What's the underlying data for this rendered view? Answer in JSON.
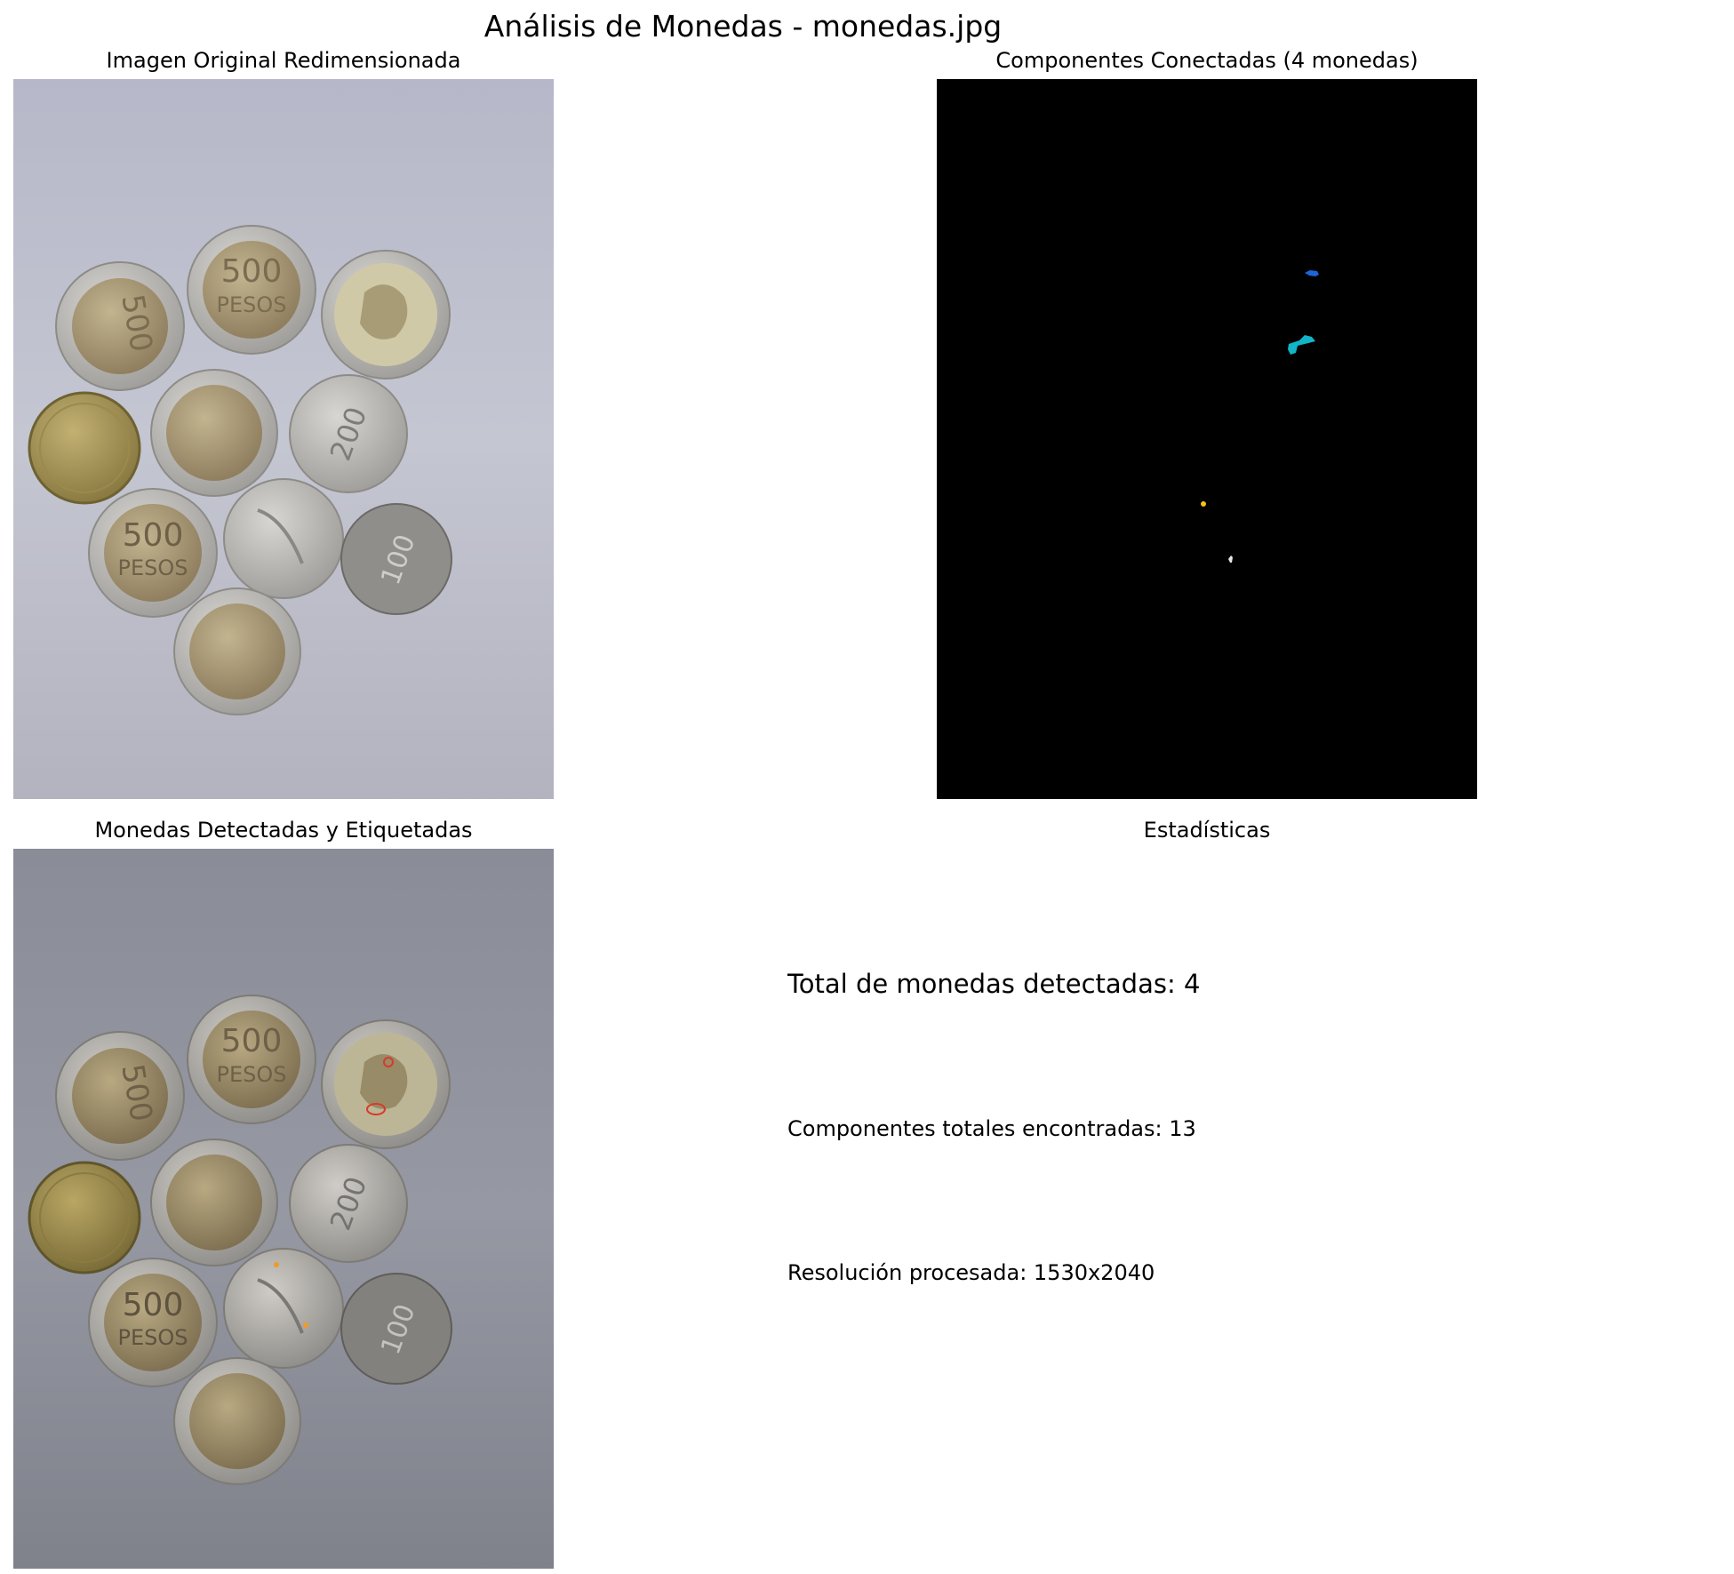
{
  "figure": {
    "suptitle": "Análisis de Monedas - monedas.jpg"
  },
  "panels": {
    "original": {
      "title": "Imagen Original Redimensionada"
    },
    "components": {
      "title": "Componentes Conectadas (4 monedas)"
    },
    "detected": {
      "title": "Monedas Detectadas y Etiquetadas"
    },
    "stats": {
      "title": "Estadísticas"
    }
  },
  "stats": {
    "total_line": "Total de monedas detectadas: 4",
    "components_line": "Componentes totales encontradas: 13",
    "resolution_line": "Resolución procesada: 1530x2040"
  },
  "chart_data": [
    {
      "type": "image",
      "title": "Imagen Original Redimensionada",
      "content": "photo of 10 coins on a grey background"
    },
    {
      "type": "image",
      "title": "Componentes Conectadas (4 monedas)",
      "content": "black label map with 4 small coloured connected components",
      "components_colors": [
        "#1e64d8",
        "#12b5c8",
        "#f2c315",
        "#e6e6e6"
      ]
    },
    {
      "type": "image",
      "title": "Monedas Detectadas y Etiquetadas",
      "content": "darkened photo of the coins with small coloured labels"
    },
    {
      "type": "text",
      "title": "Estadísticas",
      "total_monedas": 4,
      "componentes_totales": 13,
      "resolucion": "1530x2040"
    }
  ],
  "colors": {
    "background": "#ffffff",
    "photo_bg_light": "#b9bccb",
    "photo_bg_dark": "#8b8d97",
    "components_bg": "#000000",
    "bimetal_outer": "#c9c6bd",
    "bimetal_inner": "#a8997a",
    "brass": "#a8975a",
    "silver": "#b4b2ae"
  },
  "coin_labels": {
    "five_hundred": "500",
    "pesos": "PESOS",
    "two_hundred": "200",
    "one_hundred": "100"
  }
}
